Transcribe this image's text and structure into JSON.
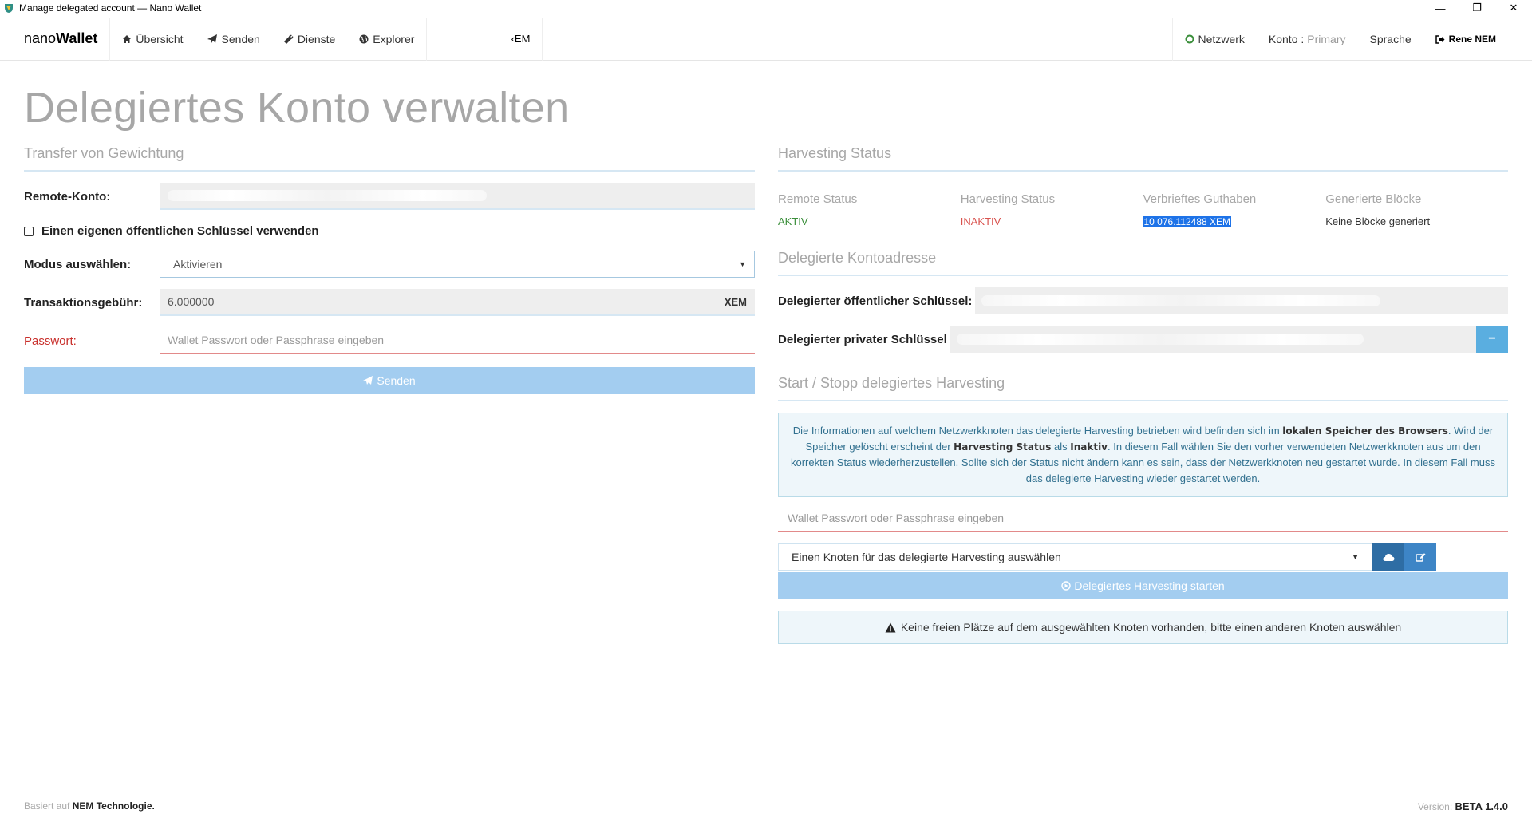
{
  "window": {
    "title": "Manage delegated account — Nano Wallet",
    "controls": {
      "minimize": "—",
      "restore": "❐",
      "close": "✕"
    }
  },
  "navbar": {
    "brand_light": "nano",
    "brand_bold": "Wallet",
    "items": [
      {
        "label": "Übersicht",
        "icon": "home-icon"
      },
      {
        "label": "Senden",
        "icon": "send-icon"
      },
      {
        "label": "Dienste",
        "icon": "wrench-icon"
      },
      {
        "label": "Explorer",
        "icon": "globe-icon"
      }
    ],
    "ticker": "‹EM",
    "right": {
      "network": "Netzwerk",
      "account_label": "Konto :",
      "account_value": "Primary",
      "language": "Sprache",
      "user": "Rene NEM"
    }
  },
  "page": {
    "title": "Delegiertes Konto verwalten"
  },
  "transfer": {
    "section_title": "Transfer von Gewichtung",
    "remote_label": "Remote-Konto:",
    "own_key_label": "Einen eigenen öffentlichen Schlüssel verwenden",
    "mode_label": "Modus auswählen:",
    "mode_value": "Aktivieren",
    "fee_label": "Transaktionsgebühr:",
    "fee_value": "6.000000",
    "fee_unit": "XEM",
    "password_label": "Passwort:",
    "password_placeholder": "Wallet Passwort oder Passphrase eingeben",
    "send_label": "Senden"
  },
  "harvesting": {
    "section_title": "Harvesting Status",
    "columns": [
      {
        "head": "Remote Status",
        "value": "AKTIV"
      },
      {
        "head": "Harvesting Status",
        "value": "INAKTIV"
      },
      {
        "head": "Verbrieftes Guthaben",
        "value": "10 076.112488 XEM"
      },
      {
        "head": "Generierte Blöcke",
        "value": "Keine Blöcke generiert"
      }
    ]
  },
  "delegated": {
    "section_title": "Delegierte Kontoadresse",
    "public_key_label": "Delegierter öffentlicher Schlüssel:",
    "private_key_label": "Delegierter privater Schlüssel",
    "toggle_label": "−"
  },
  "startstop": {
    "section_title": "Start / Stopp delegiertes Harvesting",
    "info": {
      "t1": "Die Informationen auf welchem Netzwerkknoten das delegierte Harvesting betrieben wird befinden sich im ",
      "b1": "lokalen Speicher des Browsers",
      "t2": ". Wird der Speicher gelöscht erscheint der ",
      "b2": "Harvesting Status",
      "t3": " als ",
      "b3": "Inaktiv",
      "t4": ". In diesem Fall wählen Sie den vorher verwendeten Netzwerkknoten aus um den korrekten Status wiederherzustellen. Sollte sich der Status nicht ändern kann es sein, dass der Netzwerkknoten neu gestartet wurde. In diesem Fall muss das delegierte Harvesting wieder gestartet werden."
    },
    "password_placeholder": "Wallet Passwort oder Passphrase eingeben",
    "node_select": "Einen Knoten für das delegierte Harvesting auswählen",
    "start_label": "Delegiertes Harvesting starten",
    "warning": "Keine freien Plätze auf dem ausgewählten Knoten vorhanden, bitte einen anderen Knoten auswählen"
  },
  "footer": {
    "left_prefix": "Basiert auf",
    "left_bold": "NEM Technologie.",
    "right_prefix": "Version:",
    "right_bold": "BETA 1.4.0"
  }
}
